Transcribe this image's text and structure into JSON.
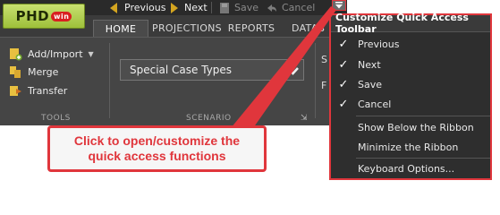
{
  "app": {
    "logo": "PHD",
    "logo_badge": "win"
  },
  "qat": {
    "previous": "Previous",
    "next": "Next",
    "save": "Save",
    "cancel": "Cancel"
  },
  "tabs": [
    "HOME",
    "PROJECTIONS",
    "REPORTS",
    "DATAB"
  ],
  "ribbon": {
    "tools": {
      "add_import": "Add/Import",
      "merge": "Merge",
      "transfer": "Transfer",
      "group_label": "TOOLS"
    },
    "scenario": {
      "combo_value": "Special Case Types",
      "group_label": "SCENARIO",
      "edge_letter_1": "S",
      "edge_letter_2": "F"
    }
  },
  "menu": {
    "title": "Customize Quick Access Toolbar",
    "items": [
      {
        "label": "Previous",
        "checked": true
      },
      {
        "label": "Next",
        "checked": true
      },
      {
        "label": "Save",
        "checked": true
      },
      {
        "label": "Cancel",
        "checked": true
      },
      {
        "label": "Show Below the Ribbon",
        "checked": false
      },
      {
        "label": "Minimize the Ribbon",
        "checked": false
      },
      {
        "label": "Keyboard Options...",
        "checked": false
      }
    ],
    "check_glyph": "✓"
  },
  "callout": {
    "line1": "Click to open/customize the",
    "line2": "quick access functions"
  },
  "colors": {
    "accent_red": "#e0363c",
    "logo_green": "#9ec03a",
    "nav_arrow": "#d4a520"
  }
}
